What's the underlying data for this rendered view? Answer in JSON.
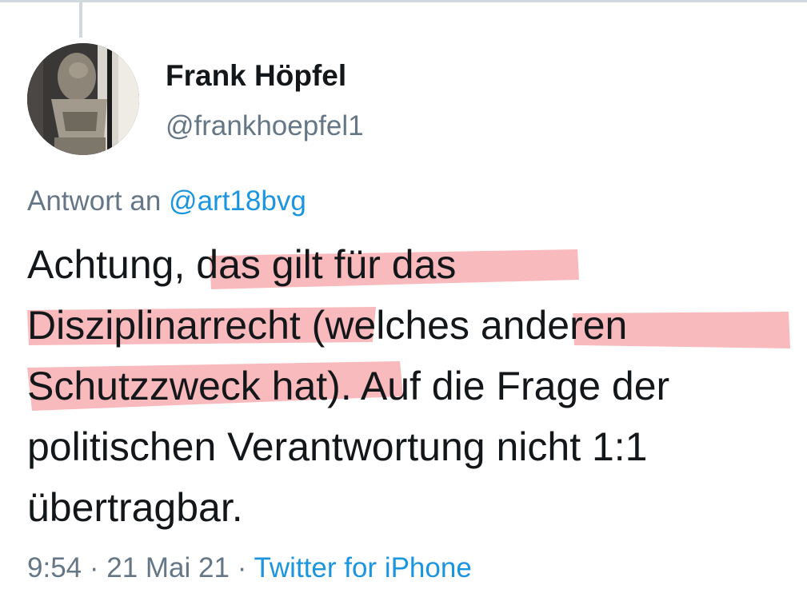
{
  "colors": {
    "text": "#14171a",
    "secondary": "#657786",
    "link": "#1b95e0",
    "highlight": "#f6a3a6"
  },
  "author": {
    "display_name": "Frank Höpfel",
    "handle": "@frankhoepfel1",
    "avatar_icon": "avatar-photo"
  },
  "reply": {
    "prefix": "Antwort an",
    "mention": "@art18bvg"
  },
  "tweet": {
    "lines": [
      "Achtung, das gilt für das",
      "Disziplinarrecht (welches anderen",
      "Schutzzweck hat). Auf die Frage der",
      "politischen Verantwortung nicht 1:1",
      "übertragbar."
    ]
  },
  "meta": {
    "time": "9:54",
    "separator": "·",
    "date": "21 Mai 21",
    "source": "Twitter for iPhone"
  }
}
